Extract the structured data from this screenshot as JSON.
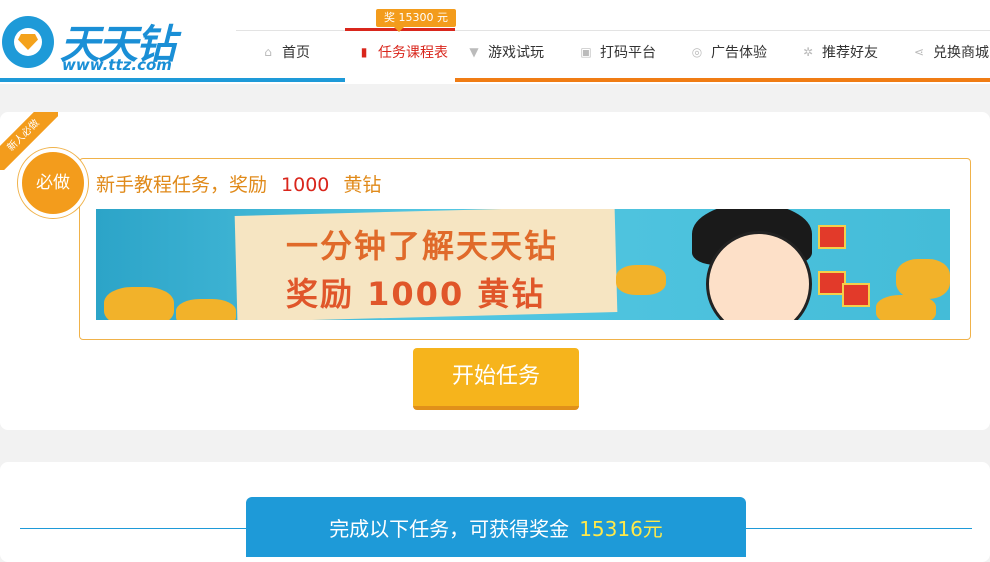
{
  "brand": {
    "name": "天天钻",
    "url": "www.ttz.com"
  },
  "nav": {
    "badge": "奖 15300 元",
    "items": [
      {
        "label": "首页",
        "icon": "bank-icon"
      },
      {
        "label": "任务课程表",
        "icon": "bar-chart-icon",
        "active": true
      },
      {
        "label": "游戏试玩",
        "icon": "trophy-icon"
      },
      {
        "label": "打码平台",
        "icon": "keyboard-icon"
      },
      {
        "label": "广告体验",
        "icon": "target-icon"
      },
      {
        "label": "推荐好友",
        "icon": "gear-icon"
      },
      {
        "label": "兑换商城",
        "icon": "share-icon"
      }
    ]
  },
  "newbie": {
    "ribbon": "新人必做",
    "must_label": "必做",
    "title_prefix": "新手教程任务，奖励",
    "reward_amount": "1000",
    "reward_unit": "黄钻",
    "banner_line1": "一分钟了解天天钻",
    "banner_line2": "奖励 1000 黄钻",
    "start_button": "开始任务"
  },
  "tasks_section": {
    "label_prefix": "完成以下任务，可获得奖金",
    "total": "15316元"
  },
  "colors": {
    "brand_blue": "#1e9ad8",
    "accent_orange": "#f39c1c",
    "active_red": "#d9261c",
    "highlight_yellow": "#ffe94a"
  }
}
